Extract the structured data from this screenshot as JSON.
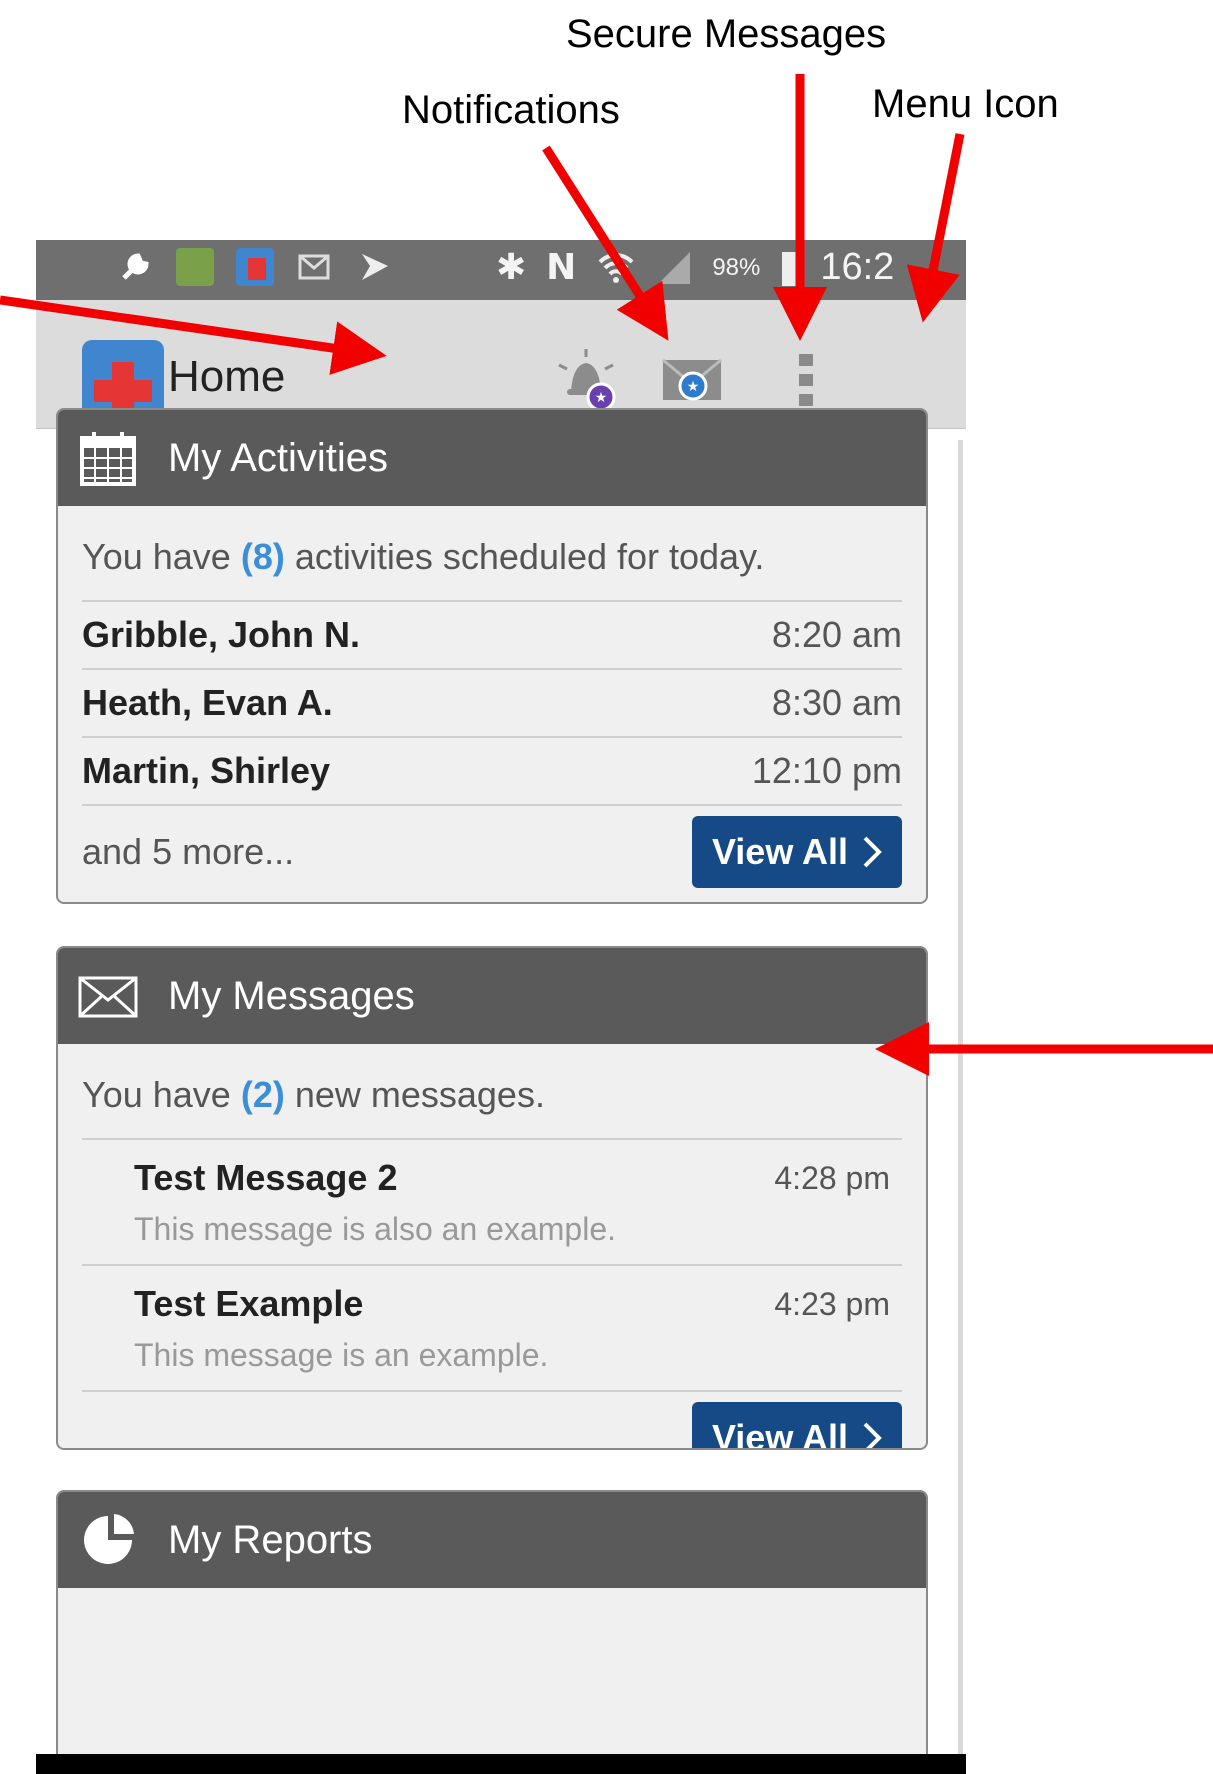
{
  "annotations": {
    "secure_messages": "Secure Messages",
    "notifications": "Notifications",
    "menu_icon": "Menu Icon"
  },
  "status_bar": {
    "battery_percent": "98%",
    "time": "16:2",
    "icons": [
      "wrench-icon",
      "gallery-icon",
      "app-icon",
      "email-icon",
      "flag-icon",
      "bluetooth-icon",
      "nfc-icon",
      "wifi-icon",
      "signal-icon",
      "battery-icon"
    ]
  },
  "app_bar": {
    "title": "Home",
    "actions": [
      "notifications-bell-icon",
      "secure-messages-icon",
      "overflow-menu-icon"
    ]
  },
  "activities": {
    "title": "My Activities",
    "summary_prefix": "You have ",
    "count": "(8)",
    "summary_suffix": " activities scheduled for today.",
    "items": [
      {
        "name": "Gribble, John N.",
        "time": "8:20 am"
      },
      {
        "name": "Heath, Evan A.",
        "time": "8:30 am"
      },
      {
        "name": "Martin, Shirley",
        "time": "12:10 pm"
      }
    ],
    "more": "and 5 more...",
    "view_all": "View All"
  },
  "messages": {
    "title": "My Messages",
    "summary_prefix": "You have ",
    "count": "(2)",
    "summary_suffix": " new messages.",
    "items": [
      {
        "subject": "Test Message 2",
        "time": "4:28 pm",
        "preview": "This message is also an example."
      },
      {
        "subject": "Test Example",
        "time": "4:23 pm",
        "preview": "This message is an example."
      }
    ],
    "view_all": "View All"
  },
  "reports": {
    "title": "My Reports"
  },
  "colors": {
    "card_header": "#5a5a5a",
    "view_all_button": "#164a87",
    "count_highlight": "#3b8ed8",
    "arrow": "#f20000"
  }
}
